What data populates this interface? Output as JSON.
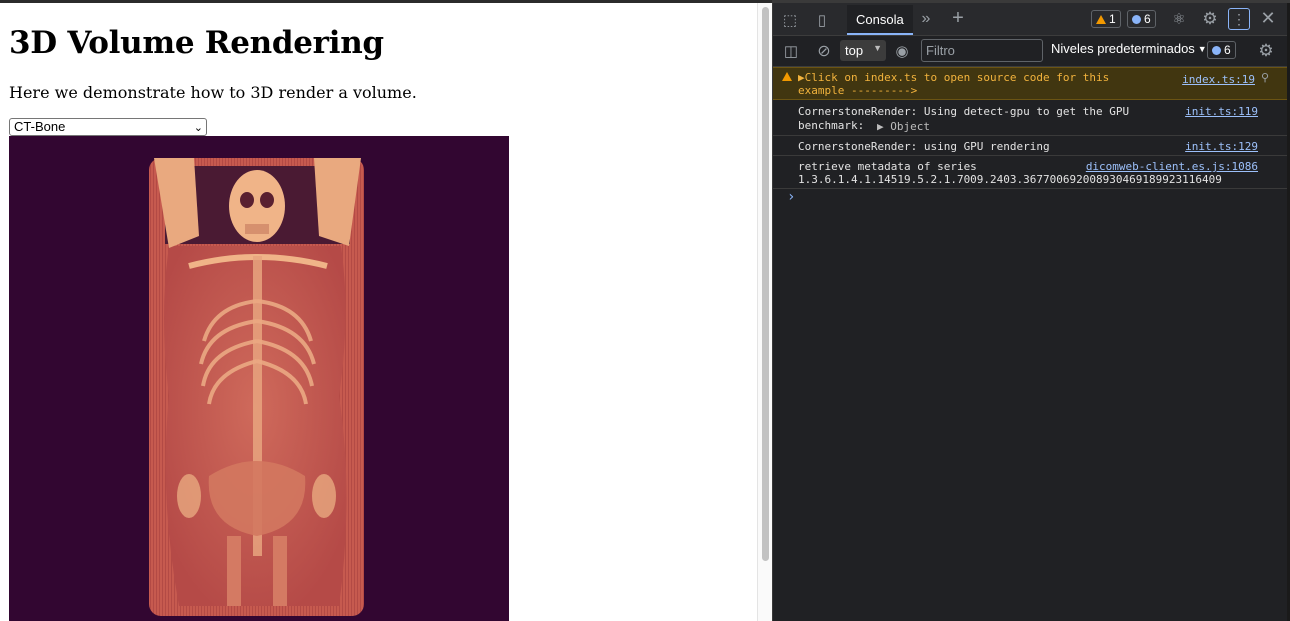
{
  "page": {
    "title": "3D Volume Rendering",
    "description": "Here we demonstrate how to 3D render a volume.",
    "preset_select": {
      "value": "CT-Bone"
    }
  },
  "devtools": {
    "tabs": {
      "console_label": "Consola"
    },
    "badges": {
      "warnings": "1",
      "messages": "6"
    },
    "toolbar": {
      "context": "top",
      "filter_placeholder": "Filtro",
      "levels_label": "Niveles predeterminados",
      "messages_count": "6"
    },
    "log": [
      {
        "type": "warning",
        "text_line1": "▶Click on index.ts to open source code for this",
        "text_line2": "example --------->",
        "source": "index.ts:19"
      },
      {
        "type": "info",
        "text_line1": "CornerstoneRender: Using detect-gpu to get the GPU",
        "text_line2": "benchmark:",
        "object_label": "▶ Object",
        "source": "init.ts:119"
      },
      {
        "type": "info",
        "text_line1": "CornerstoneRender: using GPU rendering",
        "source": "init.ts:129"
      },
      {
        "type": "info",
        "text_line1": "retrieve metadata of series",
        "text_line2": "1.3.6.1.4.1.14519.5.2.1.7009.2403.367700692008930469189923116409",
        "source": "dicomweb-client.es.js:1086"
      }
    ]
  },
  "colors": {
    "viewport_bg": "#320631",
    "body_fill": "#c65a4f",
    "bone": "#f0b488",
    "devtools_bg": "#202124",
    "warning_bg": "#413610",
    "link": "#9cc0fa"
  }
}
